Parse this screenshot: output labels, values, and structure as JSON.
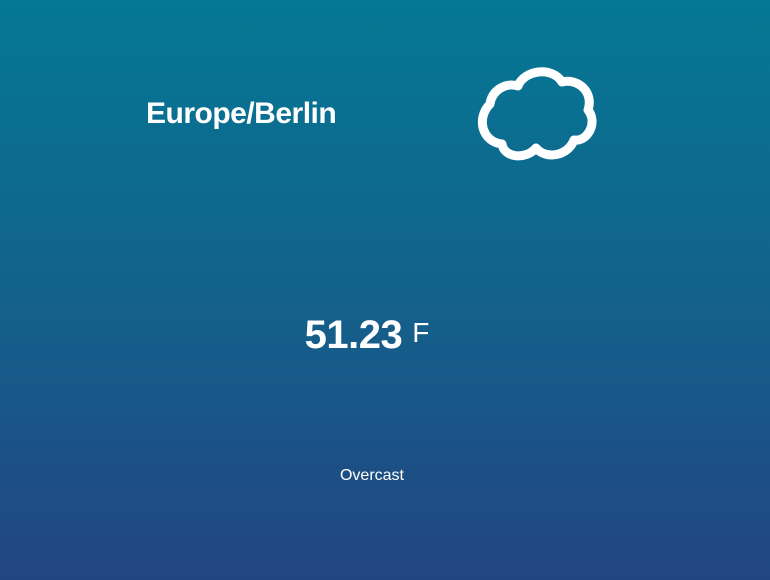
{
  "location": {
    "timezone": "Europe/Berlin"
  },
  "weather": {
    "icon": "cloud-icon",
    "temperature": "51.23",
    "unit": "F",
    "condition": "Overcast"
  },
  "colors": {
    "gradient_top": "#047894",
    "gradient_bottom": "#224581",
    "text": "#ffffff"
  }
}
